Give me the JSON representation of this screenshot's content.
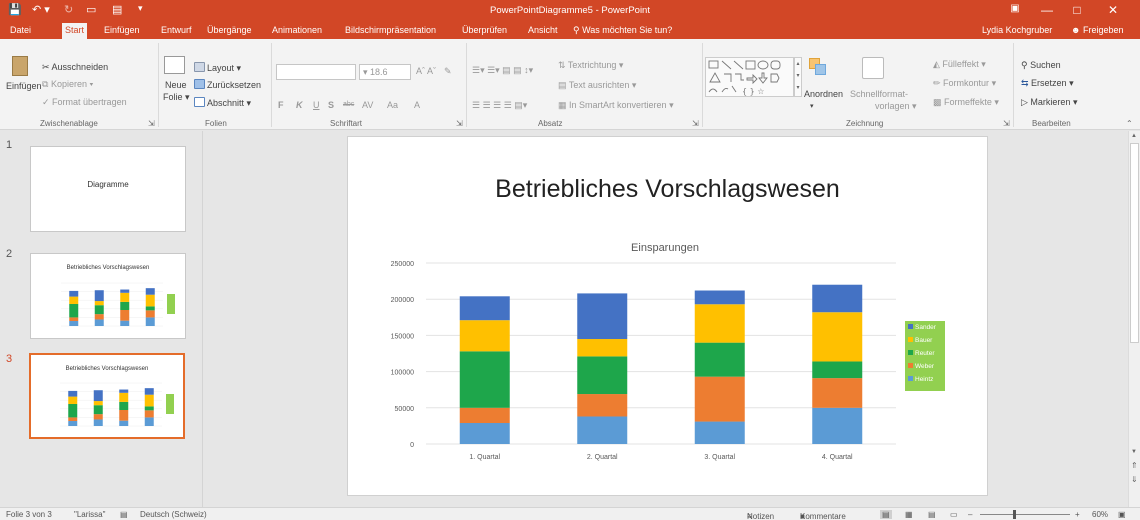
{
  "window": {
    "title": "PowerPointDiagramme5 - PowerPoint"
  },
  "tabs": [
    "Datei",
    "Start",
    "Einfügen",
    "Entwurf",
    "Übergänge",
    "Animationen",
    "Bildschirmpräsentation",
    "Überprüfen",
    "Ansicht"
  ],
  "tell_me": "Was möchten Sie tun?",
  "user": "Lydia Kochgruber",
  "share": "Freigeben",
  "ribbon": {
    "clipboard": {
      "paste": "Einfügen",
      "cut": "Ausschneiden",
      "copy": "Kopieren",
      "format_painter": "Format übertragen",
      "label": "Zwischenablage"
    },
    "slides": {
      "new_slide_1": "Neue",
      "new_slide_2": "Folie",
      "layout": "Layout",
      "reset": "Zurücksetzen",
      "section": "Abschnitt",
      "label": "Folien"
    },
    "font": {
      "size": "18.6",
      "label": "Schriftart",
      "bold": "F",
      "italic": "K",
      "underline": "U",
      "shadow": "S",
      "strike": "abc",
      "spacing": "AV",
      "case": "Aa",
      "color": "A"
    },
    "paragraph": {
      "direction": "Textrichtung",
      "align_text": "Text ausrichten",
      "smartart": "In SmartArt konvertieren",
      "label": "Absatz"
    },
    "drawing": {
      "arrange": "Anordnen",
      "quick_styles_1": "Schnellformat-",
      "quick_styles_2": "vorlagen",
      "fill": "Fülleffekt",
      "outline": "Formkontur",
      "effects": "Formeffekte",
      "label": "Zeichnung"
    },
    "editing": {
      "find": "Suchen",
      "replace": "Ersetzen",
      "select": "Markieren",
      "label": "Bearbeiten"
    }
  },
  "thumbnails": [
    {
      "num": "1",
      "title": "Diagramme"
    },
    {
      "num": "2",
      "title": "Betriebliches Vorschlagswesen"
    },
    {
      "num": "3",
      "title": "Betriebliches Vorschlagswesen"
    }
  ],
  "slide": {
    "title": "Betriebliches Vorschlagswesen"
  },
  "chart_data": {
    "type": "bar",
    "stacked": true,
    "title": "Einsparungen",
    "categories": [
      "1. Quartal",
      "2. Quartal",
      "3. Quartal",
      "4. Quartal"
    ],
    "ylim": [
      0,
      250000
    ],
    "yticks": [
      0,
      50000,
      100000,
      150000,
      200000,
      250000
    ],
    "series": [
      {
        "name": "Heintz",
        "color": "#5b9bd5",
        "values": [
          29000,
          38000,
          31000,
          50000
        ]
      },
      {
        "name": "Weber",
        "color": "#ed7d31",
        "values": [
          21000,
          31000,
          62000,
          41000
        ]
      },
      {
        "name": "Reuter",
        "color": "#1ea64b",
        "values": [
          78000,
          52000,
          47000,
          23000
        ]
      },
      {
        "name": "Bauer",
        "color": "#ffc000",
        "values": [
          43000,
          24000,
          53000,
          68000
        ]
      },
      {
        "name": "Sander",
        "color": "#4472c4",
        "values": [
          33000,
          63000,
          19000,
          38000
        ]
      }
    ],
    "legend_position": "right",
    "legend_bg": "#92d050",
    "grid": true
  },
  "status": {
    "slide": "Folie 3 von 3",
    "theme": "\"Larissa\"",
    "language": "Deutsch (Schweiz)",
    "notes": "Notizen",
    "comments": "Kommentare",
    "zoom": "60%"
  }
}
